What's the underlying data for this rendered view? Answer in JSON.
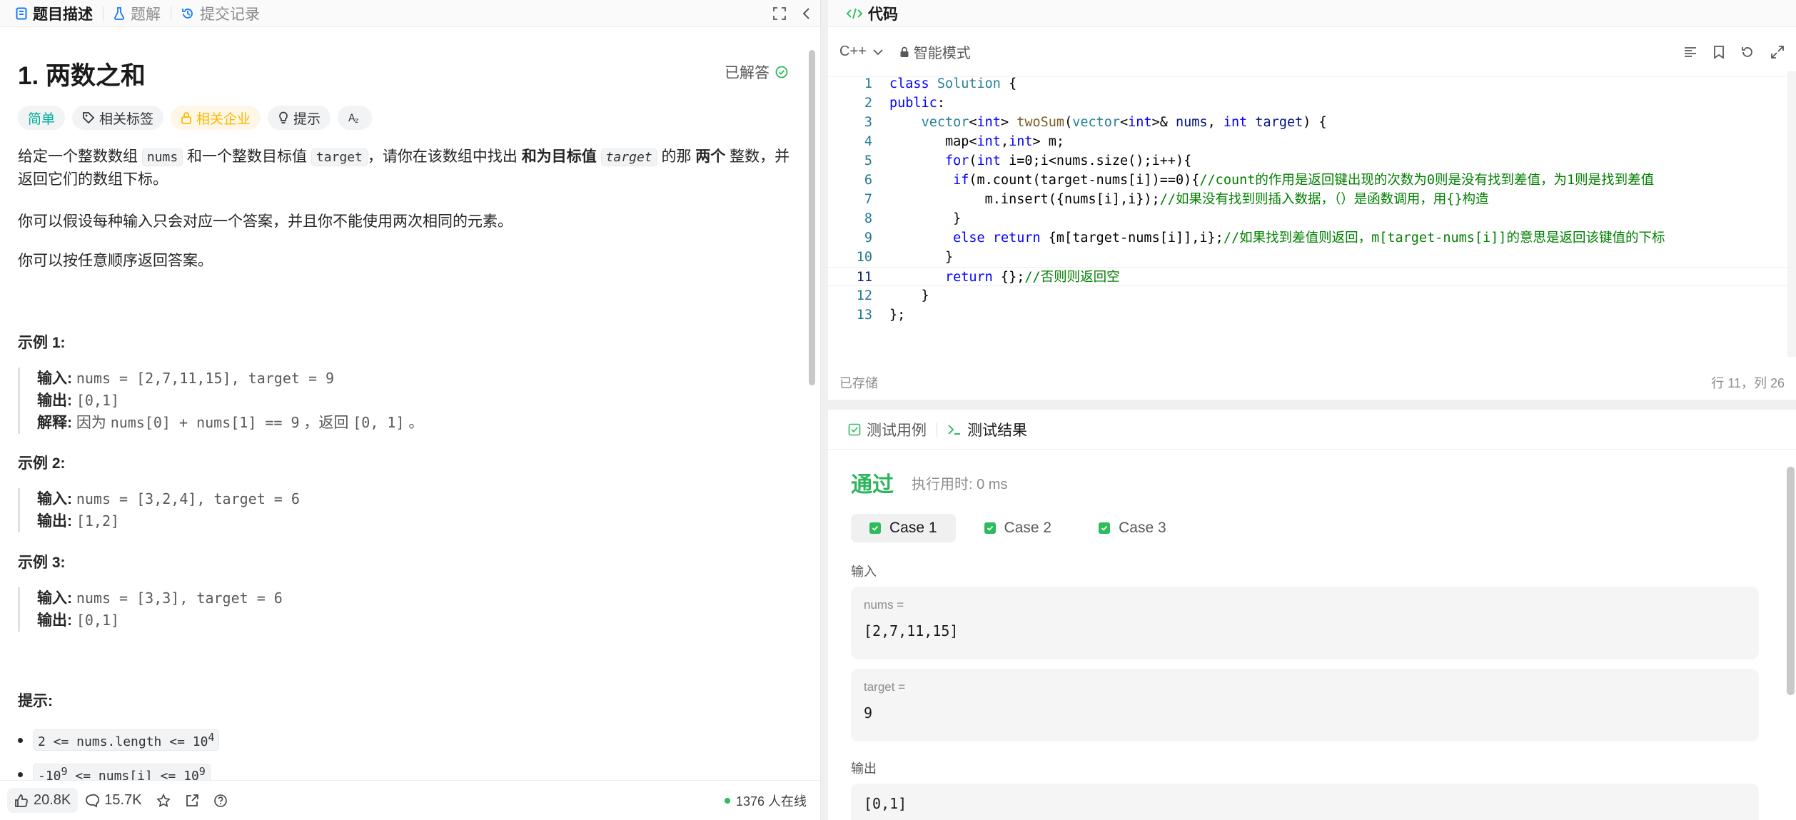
{
  "left_tabs": [
    {
      "label": "题目描述",
      "icon": "document-icon",
      "active": true
    },
    {
      "label": "题解",
      "icon": "flask-icon",
      "active": false
    },
    {
      "label": "提交记录",
      "icon": "history-icon",
      "active": false
    }
  ],
  "problem": {
    "title": "1. 两数之和",
    "status": "已解答",
    "tags": {
      "difficulty": "简单",
      "related_tags": "相关标签",
      "companies": "相关企业",
      "hint": "提示"
    },
    "desc_1_a": "给定一个整数数组 ",
    "desc_1_code1": "nums",
    "desc_1_b": " 和一个整数目标值 ",
    "desc_1_code2": "target",
    "desc_1_c": "，请你在该数组中找出 ",
    "desc_1_bold": "和为目标值",
    "desc_1_code3": "target",
    "desc_1_d": " 的那 ",
    "desc_1_bold2": "两个",
    "desc_1_e": " 整数，并",
    "desc_1_line2": "返回它们的数组下标。",
    "desc_2": "你可以假设每种输入只会对应一个答案，并且你不能使用两次相同的元素。",
    "desc_3": "你可以按任意顺序返回答案。",
    "examples": [
      {
        "heading": "示例 1:",
        "input_label": "输入:",
        "input": "nums = [2,7,11,15], target = 9",
        "output_label": "输出:",
        "output": "[0,1]",
        "explain_label": "解释:",
        "explain_a": "因为 ",
        "explain_code": "nums[0] + nums[1] == 9",
        "explain_b": " ，返回 ",
        "explain_code2": "[0, 1]",
        "explain_c": " 。"
      },
      {
        "heading": "示例 2:",
        "input_label": "输入:",
        "input": "nums = [3,2,4], target = 6",
        "output_label": "输出:",
        "output": "[1,2]"
      },
      {
        "heading": "示例 3:",
        "input_label": "输入:",
        "input": "nums = [3,3], target = 6",
        "output_label": "输出:",
        "output": "[0,1]"
      }
    ],
    "hints_heading": "提示:",
    "constraint_1": "2 <= nums.length <= 10",
    "constraint_1_sup": "4",
    "constraint_2": "-10",
    "constraint_2_sup": "9",
    "constraint_2_b": " <= nums[i] <= 10",
    "constraint_2_sup2": "9"
  },
  "footer": {
    "likes": "20.8K",
    "comments": "15.7K",
    "online": "1376 人在线"
  },
  "code_panel": {
    "title": "代码",
    "language": "C++",
    "mode": "智能模式",
    "saved": "已存储",
    "cursor": "行 11，列 26",
    "lines": [
      "1",
      "2",
      "3",
      "4",
      "5",
      "6",
      "7",
      "8",
      "9",
      "10",
      "11",
      "12",
      "13"
    ]
  },
  "results": {
    "tab_testcase": "测试用例",
    "tab_result": "测试结果",
    "status": "通过",
    "runtime": "执行用时: 0 ms",
    "cases": [
      "Case 1",
      "Case 2",
      "Case 3"
    ],
    "input_label": "输入",
    "nums_key": "nums =",
    "nums_val": "[2,7,11,15]",
    "target_key": "target =",
    "target_val": "9",
    "output_label": "输出",
    "output_val": "[0,1]"
  },
  "colors": {
    "accent_green": "#2cbb5d",
    "easy": "#00af9b",
    "company": "#ffb800"
  }
}
